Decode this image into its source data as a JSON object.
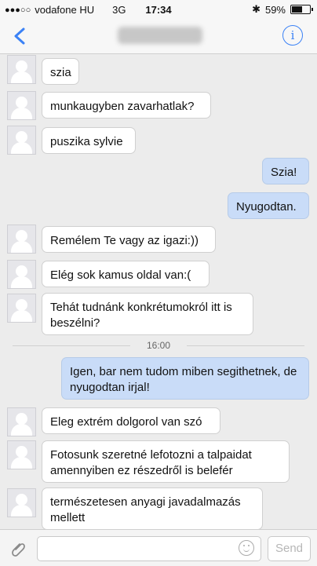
{
  "status": {
    "carrier": "vodafone HU",
    "network": "3G",
    "time": "17:34",
    "battery": "59%",
    "battery_level": 0.59
  },
  "header": {
    "back_icon": "chevron-left-icon",
    "info_icon": "info-icon",
    "accent_color": "#3b82f6"
  },
  "messages": [
    {
      "side": "in",
      "text": "szia"
    },
    {
      "side": "in",
      "text": "munkaugyben zavarhatlak?"
    },
    {
      "side": "in",
      "text": "puszika sylvie"
    },
    {
      "side": "out",
      "text": "Szia!"
    },
    {
      "side": "out",
      "text": "Nyugodtan."
    },
    {
      "side": "in",
      "text": "Remélem Te vagy az igazi:))"
    },
    {
      "side": "in",
      "text": "Elég sok kamus oldal van:("
    },
    {
      "side": "in",
      "text": "Tehát tudnánk konkrétumokról itt is beszélni?"
    },
    {
      "side": "time",
      "text": "16:00"
    },
    {
      "side": "out",
      "text": "Igen, bar nem tudom miben segithetnek, de nyugodtan irjal!"
    },
    {
      "side": "in",
      "text": "Eleg extrém dolgorol van szó"
    },
    {
      "side": "in",
      "text": "Fotosunk szeretné lefotozni a talpaidat amennyiben ez részedről is belefér"
    },
    {
      "side": "in",
      "text": "természetesen anyagi javadalmazás mellett"
    }
  ],
  "composer": {
    "placeholder": "",
    "send_label": "Send",
    "attach_icon": "paperclip-icon",
    "emoji_icon": "smiley-icon"
  }
}
